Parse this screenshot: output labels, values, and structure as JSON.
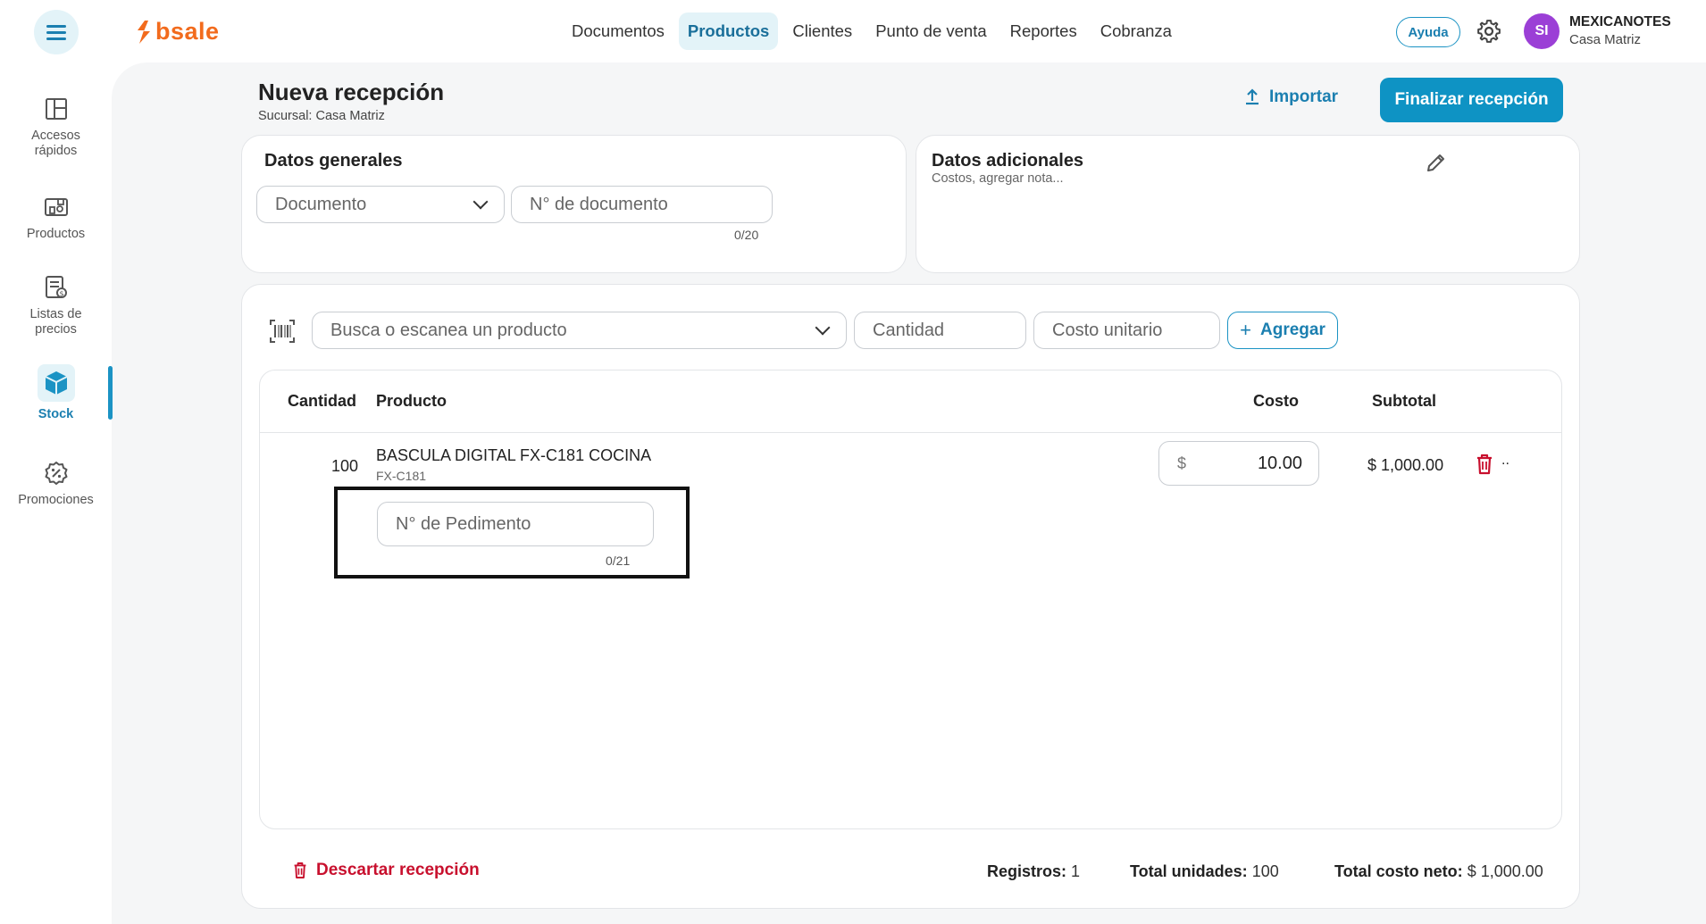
{
  "header": {
    "logo_text": "bsale",
    "nav": [
      "Documentos",
      "Productos",
      "Clientes",
      "Punto de venta",
      "Reportes",
      "Cobranza"
    ],
    "nav_active": "Productos",
    "help_label": "Ayuda",
    "avatar_initials": "SI",
    "company_name": "MEXICANOTES",
    "company_branch": "Casa Matriz"
  },
  "sidebar": {
    "items": [
      {
        "label_1": "Accesos",
        "label_2": "rápidos",
        "icon": "layout-icon"
      },
      {
        "label_1": "Productos",
        "label_2": "",
        "icon": "products-icon"
      },
      {
        "label_1": "Listas de",
        "label_2": "precios",
        "icon": "price-list-icon"
      },
      {
        "label_1": "Stock",
        "label_2": "",
        "icon": "box-icon"
      },
      {
        "label_1": "Promociones",
        "label_2": "",
        "icon": "discount-icon"
      }
    ],
    "active": "Stock"
  },
  "page": {
    "title": "Nueva recepción",
    "subtitle": "Sucursal: Casa Matriz",
    "import_label": "Importar",
    "finish_label": "Finalizar recepción"
  },
  "general": {
    "title": "Datos generales",
    "document_placeholder": "Documento",
    "doc_number_placeholder": "N° de documento",
    "doc_number_counter": "0/20"
  },
  "additional": {
    "title": "Datos adicionales",
    "subtitle": "Costos, agregar nota..."
  },
  "entry": {
    "search_placeholder": "Busca o escanea un producto",
    "quantity_placeholder": "Cantidad",
    "unit_cost_placeholder": "Costo unitario",
    "add_label": "Agregar"
  },
  "table": {
    "headers": {
      "quantity": "Cantidad",
      "product": "Producto",
      "cost": "Costo",
      "subtotal": "Subtotal"
    },
    "rows": [
      {
        "quantity": "100",
        "product": "BASCULA DIGITAL FX-C181 COCINA",
        "sku": "FX-C181",
        "currency": "$",
        "cost": "10.00",
        "subtotal": "$ 1,000.00",
        "pedimento_placeholder": "N° de Pedimento",
        "pedimento_counter": "0/21",
        "more": ".."
      }
    ]
  },
  "footer": {
    "discard_label": "Descartar recepción",
    "records_label": "Registros:",
    "records_value": "1",
    "units_label": "Total unidades:",
    "units_value": "100",
    "net_cost_label": "Total costo neto:",
    "net_cost_value": "$ 1,000.00"
  },
  "colors": {
    "brand_orange": "#f26b1d",
    "primary_blue": "#0e93c4",
    "danger_red": "#c8102e",
    "avatar_purple": "#9b3fd6"
  }
}
